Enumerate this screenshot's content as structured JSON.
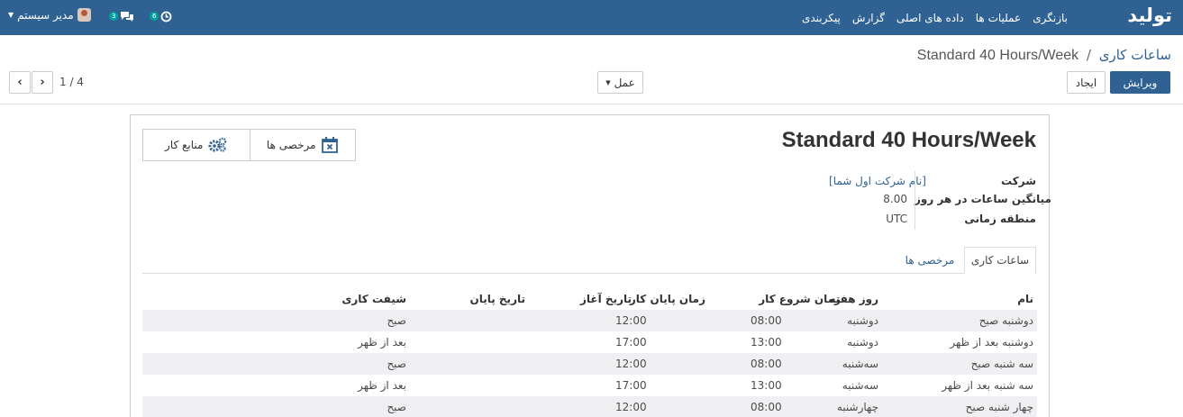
{
  "navbar": {
    "brand": "تولید",
    "menu": [
      "بازنگری",
      "عملیات ها",
      "داده های اصلی",
      "گزارش",
      "پیکربندی"
    ],
    "user_name": "مدیر سیستم",
    "chat_badge": "3",
    "activity_badge": "6"
  },
  "breadcrumb": {
    "parent": "ساعات کاری",
    "separator": "/",
    "current": "Standard 40 Hours/Week"
  },
  "toolbar": {
    "edit_label": "ویرایش",
    "create_label": "ایجاد",
    "action_label": "عمل",
    "pager": "1 / 4"
  },
  "sheet": {
    "title": "Standard 40 Hours/Week",
    "stat_leaves": "مرخصی ها",
    "stat_resources": "منابع کار",
    "fields": {
      "company_label": "شرکت",
      "company_value": "[نام شرکت اول شما]",
      "hours_label": "میانگین ساعات در هر روز",
      "hours_value": "8.00",
      "tz_label": "منطقه زمانی",
      "tz_value": "UTC"
    },
    "tabs": [
      "ساعات کاری",
      "مرخصی ها"
    ]
  },
  "table": {
    "headers": {
      "name": "نام",
      "day": "روز هفته",
      "start": "زمان شروع کار",
      "end": "زمان پایان کار",
      "from": "تاریخ آغاز",
      "to": "تاریخ پایان",
      "shift": "شیفت کاری"
    },
    "rows": [
      {
        "name": "دوشنبه صبح",
        "day": "دوشنبه",
        "start": "08:00",
        "end": "12:00",
        "from": "",
        "to": "",
        "shift": "صبح"
      },
      {
        "name": "دوشنبه بعد از ظهر",
        "day": "دوشنبه",
        "start": "13:00",
        "end": "17:00",
        "from": "",
        "to": "",
        "shift": "بعد از ظهر"
      },
      {
        "name": "سه شنبه صبح",
        "day": "سه‌شنبه",
        "start": "08:00",
        "end": "12:00",
        "from": "",
        "to": "",
        "shift": "صبح"
      },
      {
        "name": "سه شنبه بعد از ظهر",
        "day": "سه‌شنبه",
        "start": "13:00",
        "end": "17:00",
        "from": "",
        "to": "",
        "shift": "بعد از ظهر"
      },
      {
        "name": "چهار شنبه صبح",
        "day": "چهارشنبه",
        "start": "08:00",
        "end": "12:00",
        "from": "",
        "to": "",
        "shift": "صبح"
      }
    ]
  }
}
